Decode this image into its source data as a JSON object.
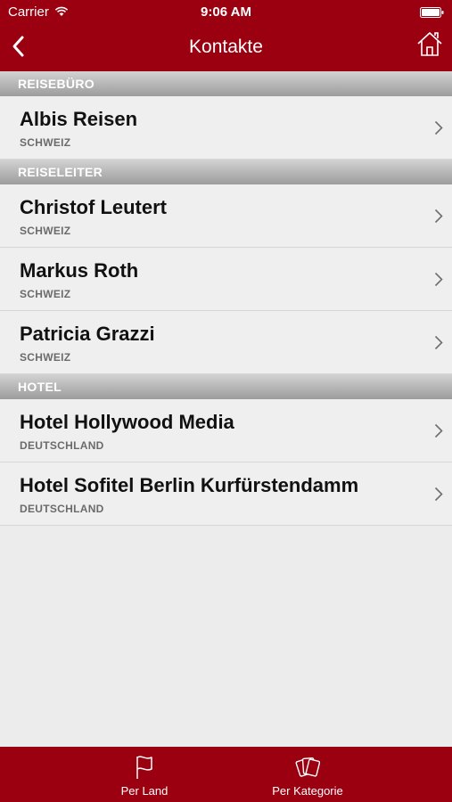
{
  "status_bar": {
    "carrier": "Carrier",
    "time": "9:06 AM"
  },
  "nav_bar": {
    "title": "Kontakte",
    "back_icon": "chevron-left-icon",
    "home_icon": "home-icon"
  },
  "sections": [
    {
      "header": "REISEBÜRO",
      "rows": [
        {
          "title": "Albis Reisen",
          "subtitle": "SCHWEIZ"
        }
      ]
    },
    {
      "header": "REISELEITER",
      "rows": [
        {
          "title": "Christof Leutert",
          "subtitle": "SCHWEIZ"
        },
        {
          "title": "Markus Roth",
          "subtitle": "SCHWEIZ"
        },
        {
          "title": "Patricia Grazzi",
          "subtitle": "SCHWEIZ"
        }
      ]
    },
    {
      "header": "HOTEL",
      "rows": [
        {
          "title": "Hotel Hollywood Media",
          "subtitle": "DEUTSCHLAND"
        },
        {
          "title": "Hotel Sofitel Berlin Kurfürstendamm",
          "subtitle": "DEUTSCHLAND"
        }
      ]
    }
  ],
  "tab_bar": {
    "tabs": [
      {
        "label": "Per Land",
        "icon": "flag-icon"
      },
      {
        "label": "Per Kategorie",
        "icon": "cards-icon"
      }
    ]
  },
  "colors": {
    "brand": "#9b0011",
    "background": "#ececec",
    "row": "#efefef"
  }
}
